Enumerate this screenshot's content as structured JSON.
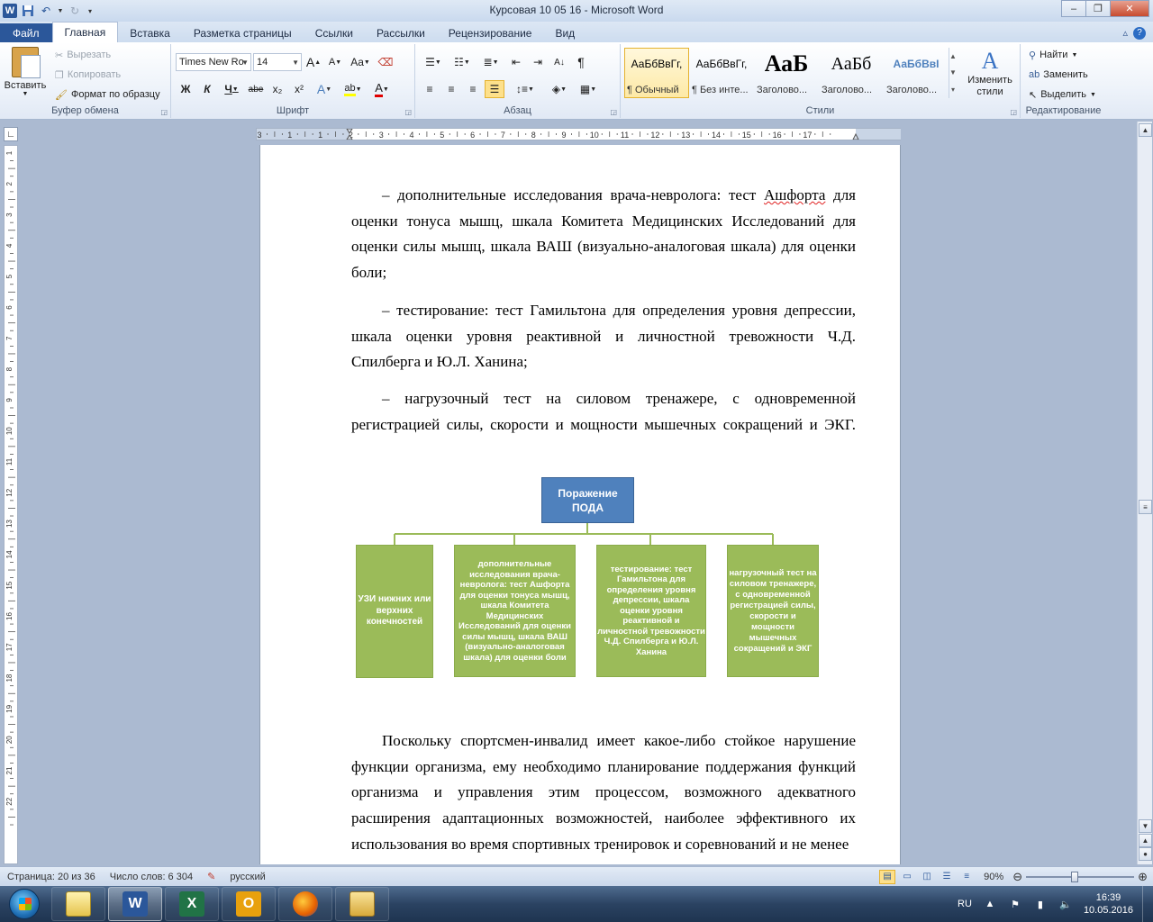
{
  "window": {
    "title": "Курсовая 10 05 16  -  Microsoft Word",
    "controls": {
      "minimize": "–",
      "maximize": "❐",
      "close": "✕"
    }
  },
  "qat": {
    "icons": [
      "word-logo",
      "save-icon",
      "undo-icon",
      "redo-icon",
      "customize-icon"
    ]
  },
  "tabs": [
    {
      "label": "Файл"
    },
    {
      "label": "Главная"
    },
    {
      "label": "Вставка"
    },
    {
      "label": "Разметка страницы"
    },
    {
      "label": "Ссылки"
    },
    {
      "label": "Рассылки"
    },
    {
      "label": "Рецензирование"
    },
    {
      "label": "Вид"
    }
  ],
  "ribbon": {
    "clipboard": {
      "label": "Буфер обмена",
      "paste": "Вставить",
      "cut": "Вырезать",
      "copy": "Копировать",
      "format_painter": "Формат по образцу"
    },
    "font": {
      "label": "Шрифт",
      "family": "Times New Ro",
      "size": "14",
      "bold": "Ж",
      "italic": "К",
      "underline": "Ч",
      "strike": "abe",
      "subscript": "x₂",
      "superscript": "x²",
      "grow": "A",
      "shrink": "A",
      "case": "Aa",
      "highlight": "ab",
      "color": "A"
    },
    "paragraph": {
      "label": "Абзац",
      "show_marks": "¶"
    },
    "styles": {
      "label": "Стили",
      "items": [
        {
          "preview": "АаБбВвГг,",
          "name": "¶ Обычный"
        },
        {
          "preview": "АаБбВвГг,",
          "name": "¶ Без инте..."
        },
        {
          "preview": "АаБ",
          "name": "Заголово..."
        },
        {
          "preview": "АаБб",
          "name": "Заголово..."
        },
        {
          "preview": "АаБбВвІ",
          "name": "Заголово..."
        }
      ],
      "change_styles": "Изменить стили"
    },
    "editing": {
      "label": "Редактирование",
      "find": "Найти",
      "replace": "Заменить",
      "select": "Выделить"
    }
  },
  "ruler": {
    "numbers": [
      "3",
      "1",
      "1",
      "2",
      "3",
      "4",
      "5",
      "6",
      "7",
      "8",
      "9",
      "10",
      "11",
      "12",
      "13",
      "14",
      "15",
      "16",
      "17"
    ]
  },
  "document": {
    "p1_dash": "– дополнительные исследования врача-невролога: тест ",
    "p1_misspelled": "Ашфорта",
    "p1_rest": " для оценки тонуса мышц, шкала Комитета Медицинских Исследований для оценки силы мышц, шкала ВАШ (визуально-аналоговая шкала) для оценки боли;",
    "p2": "– тестирование: тест Гамильтона для определения уровня депрессии, шкала оценки уровня реактивной и личностной тревожности Ч.Д. Спилберга и Ю.Л. Ханина;",
    "p3": "– нагрузочный тест на силовом тренажере, с одновременной регистрацией силы, скорости и мощности мышечных сокращений и ЭКГ.",
    "p4": "Поскольку спортсмен-инвалид имеет какое-либо стойкое нарушение функции организма, ему необходимо планирование поддержания функций организма и управления этим процессом, возможного адекватного расширения адаптационных возможностей, наиболее эффективного их использования во время спортивных тренировок и соревнований и не менее"
  },
  "diagram": {
    "top": "Поражение ПОДА",
    "children": [
      "УЗИ нижних или верхних конечностей",
      "дополнительные исследования врача-невролога: тест Ашфорта для оценки тонуса мышц, шкала Комитета Медицинских Исследований для оценки силы мышц, шкала ВАШ (визуально-аналоговая шкала) для оценки боли",
      "тестирование: тест Гамильтона для определения уровня депрессии, шкала оценки уровня реактивной и личностной тревожности Ч.Д. Спилберга и Ю.Л. Ханина",
      "нагрузочный тест на силовом тренажере, с одновременной регистрацией силы, скорости и мощности мышечных сокращений и ЭКГ"
    ],
    "colors": {
      "top": "#4f81bd",
      "child": "#9bbb59",
      "connector": "#9bbb59"
    }
  },
  "vruler": {
    "numbers": [
      "1",
      "2",
      "3",
      "4",
      "5",
      "6",
      "7",
      "8",
      "9",
      "10",
      "11",
      "12",
      "13",
      "14",
      "15",
      "16",
      "17",
      "18",
      "19",
      "20",
      "21",
      "22"
    ]
  },
  "statusbar": {
    "page": "Страница: 20 из 36",
    "words": "Число слов: 6 304",
    "language": "русский",
    "zoom": "90%",
    "zoom_fraction": 0.45
  },
  "taskbar": {
    "lang": "RU",
    "time": "16:39",
    "date": "10.05.2016",
    "apps": [
      "explorer-icon",
      "word-icon",
      "excel-icon",
      "outlook-icon",
      "firefox-icon",
      "folder-icon"
    ]
  }
}
